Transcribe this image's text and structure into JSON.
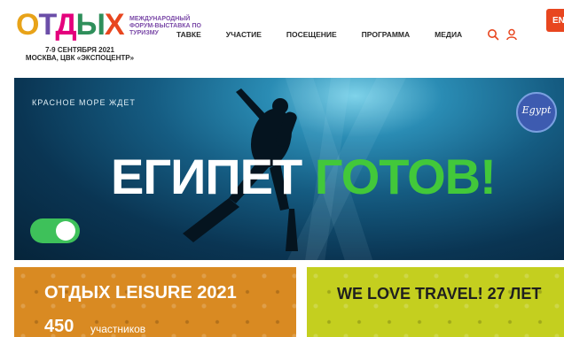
{
  "logo": {
    "letters": [
      "О",
      "Т",
      "Д",
      "Ы",
      "Х"
    ],
    "subtitle": "МЕЖДУНАРОДНЫЙ ФОРУМ-ВЫСТАВКА ПО ТУРИЗМУ"
  },
  "event": {
    "dates": "7-9 СЕНТЯБРЯ 2021",
    "venue": "МОСКВА, ЦВК «ЭКСПОЦЕНТР»"
  },
  "nav": {
    "items": [
      "ТАВКЕ",
      "УЧАСТИЕ",
      "ПОСЕЩЕНИЕ",
      "ПРОГРАММА",
      "МЕДИА"
    ]
  },
  "header": {
    "cta_label": "EN",
    "icons": [
      "search-icon",
      "user-icon"
    ]
  },
  "hero": {
    "tagline": "КРАСНОЕ МОРЕ ЖДЕТ",
    "title_word1": "ЕГИПЕТ",
    "title_word2": "ГОТОВ!",
    "badge_text": "Egypt",
    "toggle_on": true
  },
  "cards": [
    {
      "title": "ОТДЫХ LEISURE 2021",
      "count": "450",
      "count_label": "участников"
    },
    {
      "title": "WE LOVE TRAVEL! 27 ЛЕТ"
    }
  ],
  "colors": {
    "accent_orange": "#e8461f",
    "title_green": "#42c83a",
    "card_orange": "#d98a22",
    "card_lime": "#c4cf1f"
  }
}
